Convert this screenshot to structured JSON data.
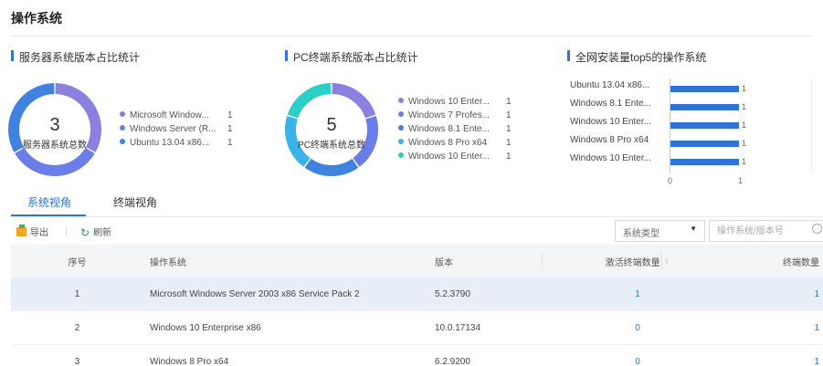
{
  "page": {
    "title": "操作系统"
  },
  "server_panel": {
    "title": "服务器系统版本占比统计",
    "total": "3",
    "total_label": "服务器系统总数",
    "legend": [
      {
        "label": "Microsoft Window...",
        "value": "1",
        "color": "#8b7fe0"
      },
      {
        "label": "Windows Server (R...",
        "value": "1",
        "color": "#6a7de8"
      },
      {
        "label": "Ubuntu 13.04 x86...",
        "value": "1",
        "color": "#3f82e0"
      }
    ]
  },
  "pc_panel": {
    "title": "PC终端系统版本占比统计",
    "total": "5",
    "total_label": "PC终端系统总数",
    "legend": [
      {
        "label": "Windows 10 Enter...",
        "value": "1",
        "color": "#8b7fe0"
      },
      {
        "label": "Windows 7 Profes...",
        "value": "1",
        "color": "#6a7de8"
      },
      {
        "label": "Windows 8.1 Ente...",
        "value": "1",
        "color": "#3f82e0"
      },
      {
        "label": "Windows 8 Pro x64",
        "value": "1",
        "color": "#3bb3e8"
      },
      {
        "label": "Windows 10 Enter...",
        "value": "1",
        "color": "#2ccfc5"
      }
    ]
  },
  "top5_panel": {
    "title": "全网安装量top5的操作系统",
    "ticks": [
      "0",
      "1"
    ]
  },
  "tabs": [
    {
      "label": "系统视角",
      "active": true
    },
    {
      "label": "终端视角",
      "active": false
    }
  ],
  "toolbar": {
    "export_label": "导出",
    "refresh_label": "刷新",
    "filter_placeholder": "系统类型",
    "search_placeholder": "操作系统/版本号"
  },
  "table": {
    "columns": [
      "序号",
      "操作系统",
      "版本",
      "激活终端数量",
      "终端数量"
    ],
    "rows": [
      {
        "idx": "1",
        "os": "Microsoft Windows Server 2003 x86 Service Pack 2",
        "version": "5.2.3790",
        "active": "1",
        "terminals": "1"
      },
      {
        "idx": "2",
        "os": "Windows 10 Enterprise x86",
        "version": "10.0.17134",
        "active": "0",
        "terminals": "1"
      },
      {
        "idx": "3",
        "os": "Windows 8 Pro x64",
        "version": "6.2.9200",
        "active": "0",
        "terminals": "1"
      }
    ]
  },
  "chart_data": [
    {
      "type": "pie",
      "title": "服务器系统版本占比统计",
      "categories": [
        "Microsoft Window...",
        "Windows Server (R...",
        "Ubuntu 13.04 x86..."
      ],
      "values": [
        1,
        1,
        1
      ]
    },
    {
      "type": "pie",
      "title": "PC终端系统版本占比统计",
      "categories": [
        "Windows 10 Enter...",
        "Windows 7 Profes...",
        "Windows 8.1 Ente...",
        "Windows 8 Pro x64",
        "Windows 10 Enter..."
      ],
      "values": [
        1,
        1,
        1,
        1,
        1
      ]
    },
    {
      "type": "bar",
      "title": "全网安装量top5的操作系统",
      "categories": [
        "Ubuntu 13.04 x86...",
        "Windows 8.1 Ente...",
        "Windows 10 Enter...",
        "Windows 8 Pro x64",
        "Windows 10 Enter..."
      ],
      "values": [
        1,
        1,
        1,
        1,
        1
      ],
      "xlim": [
        0,
        1
      ],
      "orientation": "horizontal",
      "color": "#2f74d6"
    }
  ]
}
